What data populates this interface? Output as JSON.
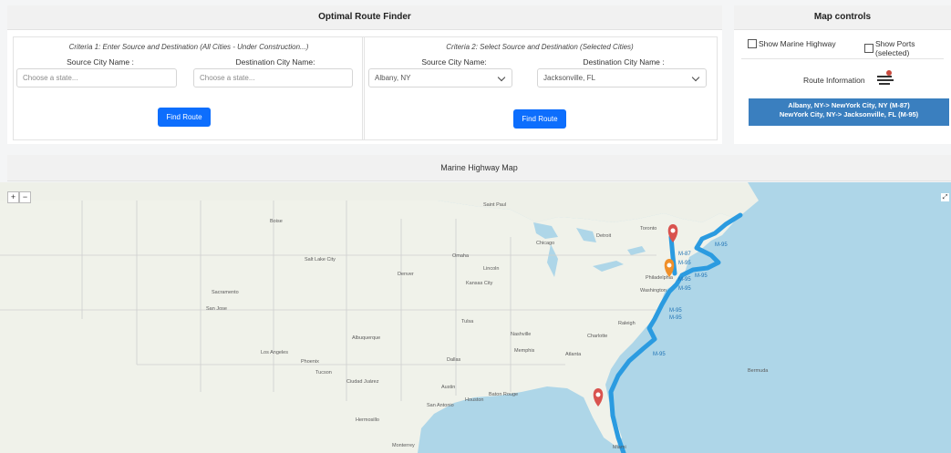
{
  "finder": {
    "title": "Optimal Route Finder",
    "criteria1": {
      "heading": "Criteria 1: Enter Source and Destination (All Cities - Under Construction...)",
      "source_label": "Source City Name :",
      "dest_label": "Destination City Name:",
      "source_placeholder": "Choose a state...",
      "dest_placeholder": "Choose a state...",
      "button": "Find Route"
    },
    "criteria2": {
      "heading": "Criteria 2: Select Source and Destination (Selected Cities)",
      "source_label": "Source City Name:",
      "dest_label": "Destination City Name :",
      "source_value": "Albany, NY",
      "dest_value": "Jacksonville, FL",
      "button": "Find Route"
    }
  },
  "controls": {
    "title": "Map controls",
    "show_marine_highway": "Show Marine Highway",
    "show_ports": "Show Ports (selected)",
    "route_info_label": "Route Information",
    "route_lines": [
      "Albany, NY-> NewYork City, NY (M-87)",
      "NewYork City, NY-> Jacksonville, FL (M-95)"
    ]
  },
  "map": {
    "title": "Marine Highway Map",
    "zoom_in": "+",
    "zoom_out": "−",
    "fullscreen": "⤢",
    "route_color": "#2b9be0",
    "route_labels": [
      "M-95",
      "M-87",
      "M-95",
      "M-95",
      "M-95",
      "M-95",
      "M-95",
      "M-95",
      "M-95"
    ],
    "place_labels": [
      "Saint Paul",
      "Boise",
      "Salt Lake City",
      "Denver",
      "Omaha",
      "Chicago",
      "Kansas City",
      "Detroit",
      "Lincoln",
      "Sacramento",
      "San Jose",
      "Los Angeles",
      "Phoenix",
      "Tucson",
      "Albuquerque",
      "Tulsa",
      "Nashville",
      "Raleigh",
      "Charlotte",
      "Atlanta",
      "Memphis",
      "Dallas",
      "Austin",
      "San Antonio",
      "Baton Rouge",
      "Ciudad Juárez",
      "Houston",
      "Hermosillo",
      "Toronto",
      "Philadelphia",
      "Washington",
      "Bermuda",
      "Miami",
      "Monterrey"
    ]
  }
}
